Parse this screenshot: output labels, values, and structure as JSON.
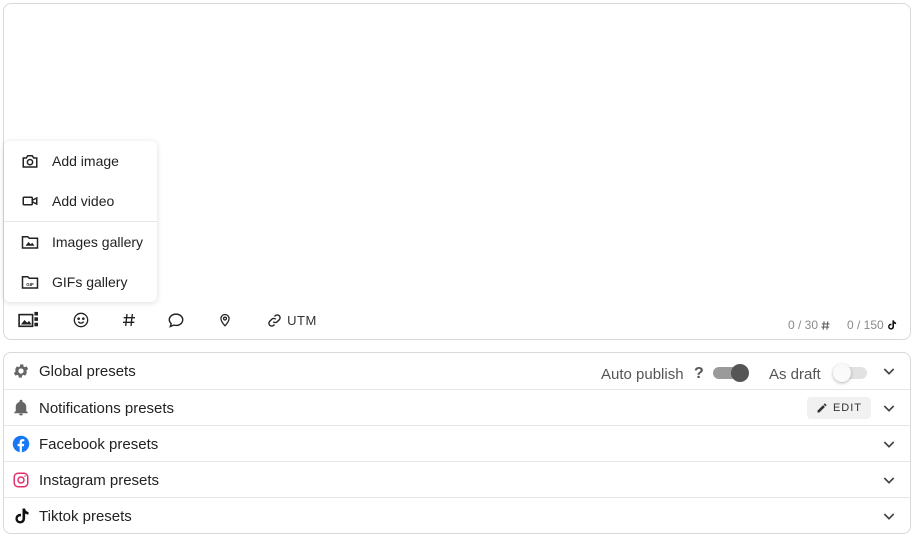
{
  "menu": {
    "items": [
      {
        "label": "Add image",
        "icon": "camera-icon"
      },
      {
        "label": "Add video",
        "icon": "video-icon"
      },
      {
        "label": "Images gallery",
        "icon": "image-folder-icon"
      },
      {
        "label": "GIFs gallery",
        "icon": "gif-folder-icon"
      }
    ]
  },
  "toolbar": {
    "media_icon": "media-icon",
    "emoji_icon": "emoji-icon",
    "hashtag_icon": "hashtag-icon",
    "comment_icon": "comment-icon",
    "location_icon": "location-pin-icon",
    "utm_label": "UTM"
  },
  "counters": {
    "hashtags": "0 / 30",
    "chars": "0 / 150"
  },
  "presets": {
    "global": {
      "label": "Global presets",
      "auto_publish_label": "Auto publish",
      "help_label": "?",
      "auto_publish_on": true,
      "as_draft_label": "As draft",
      "as_draft_on": false
    },
    "notifications": {
      "label": "Notifications presets",
      "edit_label": "EDIT"
    },
    "facebook": {
      "label": "Facebook presets"
    },
    "instagram": {
      "label": "Instagram presets"
    },
    "tiktok": {
      "label": "Tiktok presets"
    }
  },
  "colors": {
    "facebook": "#1877f2",
    "instagram": "#e1306c",
    "icon_gray": "#666666"
  }
}
